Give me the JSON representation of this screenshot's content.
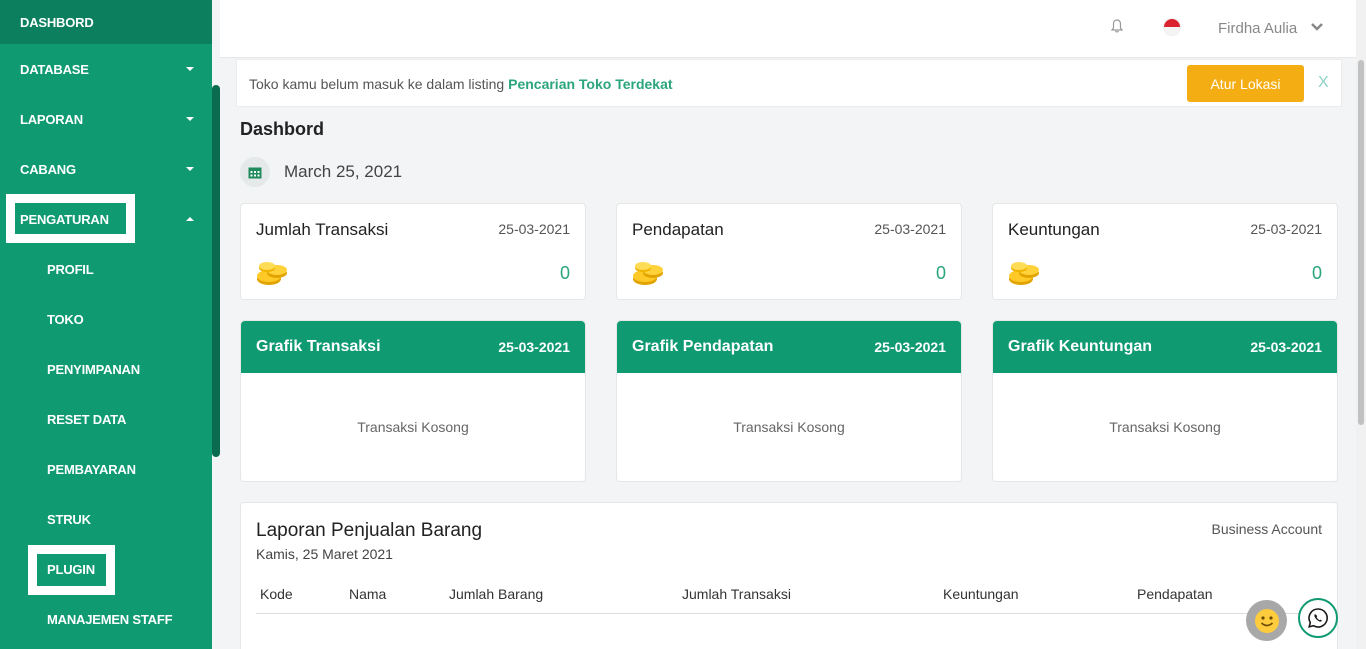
{
  "sidebar": {
    "top": "DASHBORD",
    "items": [
      {
        "label": "DATABASE"
      },
      {
        "label": "LAPORAN"
      },
      {
        "label": "CABANG"
      },
      {
        "label": "PENGATURAN"
      }
    ],
    "sub_items": [
      {
        "label": "PROFIL"
      },
      {
        "label": "TOKO"
      },
      {
        "label": "PENYIMPANAN"
      },
      {
        "label": "RESET DATA"
      },
      {
        "label": "PEMBAYARAN"
      },
      {
        "label": "STRUK"
      },
      {
        "label": "PLUGIN"
      },
      {
        "label": "MANAJEMEN STAFF"
      }
    ]
  },
  "topbar": {
    "user_name": "Firdha Aulia"
  },
  "notice": {
    "text": "Toko kamu belum masuk ke dalam listing ",
    "link": "Pencarian Toko Terdekat",
    "button": "Atur Lokasi",
    "close": "X"
  },
  "page": {
    "title": "Dashbord",
    "date": "March 25, 2021"
  },
  "stats": [
    {
      "title": "Jumlah Transaksi",
      "date": "25-03-2021",
      "value": "0"
    },
    {
      "title": "Pendapatan",
      "date": "25-03-2021",
      "value": "0"
    },
    {
      "title": "Keuntungan",
      "date": "25-03-2021",
      "value": "0"
    }
  ],
  "graphs": [
    {
      "title": "Grafik Transaksi",
      "date": "25-03-2021",
      "empty": "Transaksi Kosong"
    },
    {
      "title": "Grafik Pendapatan",
      "date": "25-03-2021",
      "empty": "Transaksi Kosong"
    },
    {
      "title": "Grafik Keuntungan",
      "date": "25-03-2021",
      "empty": "Transaksi Kosong"
    }
  ],
  "report": {
    "title": "Laporan Penjualan Barang",
    "subtitle": "Kamis, 25 Maret 2021",
    "account": "Business Account",
    "columns": [
      "Kode",
      "Nama",
      "Jumlah Barang",
      "Jumlah Transaksi",
      "Keuntungan",
      "Pendapatan"
    ]
  },
  "colors": {
    "brand": "#0f9a72",
    "accent": "#f5ad14",
    "link": "#2aa57c"
  },
  "icons": [
    "bell-icon",
    "flag-icon",
    "chevron-down-icon",
    "calendar-icon",
    "coins-icon",
    "smile-icon",
    "whatsapp-icon"
  ]
}
